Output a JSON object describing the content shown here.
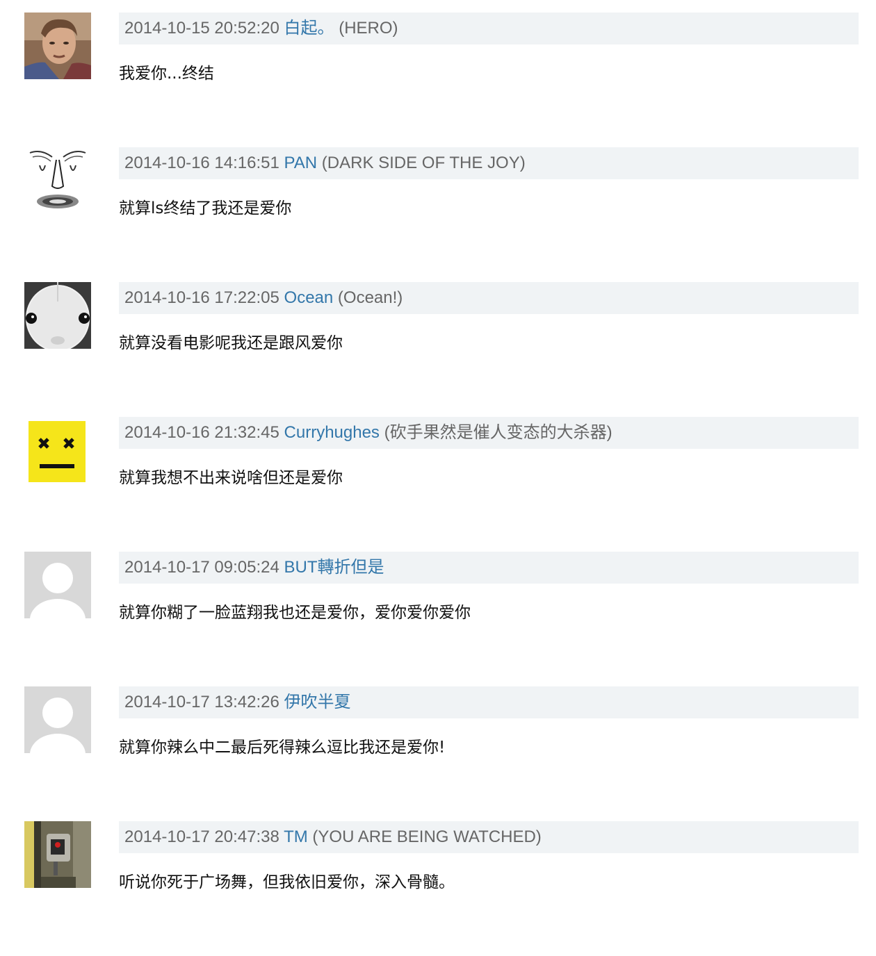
{
  "comments": [
    {
      "time": "2014-10-15 20:52:20",
      "user": "白起。",
      "signature": "(HERO)",
      "text": "我爱你...终结",
      "avatar_icon": "photo-avatar-man"
    },
    {
      "time": "2014-10-16 14:16:51",
      "user": "PAN",
      "signature": "(DARK SIDE OF THE JOY)",
      "text": "就算ls终结了我还是爱你",
      "avatar_icon": "sketch-face-avatar"
    },
    {
      "time": "2014-10-16 17:22:05",
      "user": "Ocean",
      "signature": "(Ocean!)",
      "text": "就算没看电影呢我还是跟风爱你",
      "avatar_icon": "white-creature-avatar"
    },
    {
      "time": "2014-10-16 21:32:45",
      "user": "Curryhughes",
      "signature": "(砍手果然是催人变态的大杀器)",
      "text": "就算我想不出来说啥但还是爱你",
      "avatar_icon": "yellow-face-avatar"
    },
    {
      "time": "2014-10-17 09:05:24",
      "user": "BUT轉折但是",
      "signature": "",
      "text": "就算你糊了一脸蓝翔我也还是爱你，爱你爱你爱你",
      "avatar_icon": "default-user-avatar"
    },
    {
      "time": "2014-10-17 13:42:26",
      "user": "伊吹半夏",
      "signature": "",
      "text": "就算你辣么中二最后死得辣么逗比我还是爱你!",
      "avatar_icon": "default-user-avatar"
    },
    {
      "time": "2014-10-17 20:47:38",
      "user": "TM",
      "signature": "(YOU ARE BEING WATCHED)",
      "text": "听说你死于广场舞，但我依旧爱你，深入骨髓。",
      "avatar_icon": "security-camera-avatar"
    }
  ],
  "colors": {
    "meta_bg": "#f0f3f5",
    "username": "#3377aa",
    "meta_text": "#666666",
    "body_text": "#111111"
  }
}
